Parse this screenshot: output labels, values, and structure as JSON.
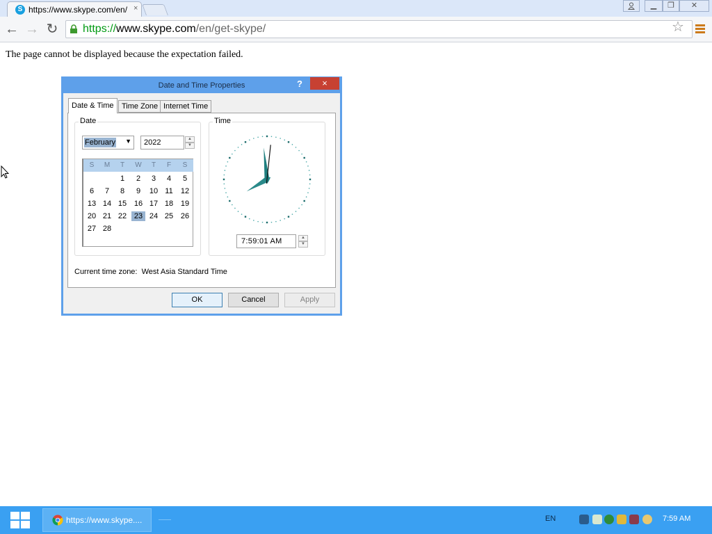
{
  "browser": {
    "tab_title": "https://www.skype.com/en/",
    "tab_close": "×",
    "url_scheme": "https://",
    "url_host": "www.skype.com",
    "url_path": "/en/get-skype/",
    "nav_back": "←",
    "nav_forward": "→",
    "nav_reload": "↻",
    "star": "☆",
    "window_controls": {
      "minimize": "▁",
      "restore": "❐",
      "close": "✕"
    },
    "accent_color": "#009a12"
  },
  "page": {
    "error_message": "The page cannot be displayed because the expectation failed."
  },
  "dialog": {
    "title": "Date and Time Properties",
    "help": "?",
    "close": "×",
    "tabs": [
      {
        "label": "Date & Time",
        "active": true
      },
      {
        "label": "Time Zone",
        "active": false
      },
      {
        "label": "Internet Time",
        "active": false
      }
    ],
    "date_group_label": "Date",
    "time_group_label": "Time",
    "month": "February",
    "year": "2022",
    "weekdays": [
      "S",
      "M",
      "T",
      "W",
      "T",
      "F",
      "S"
    ],
    "days": [
      "1",
      "2",
      "3",
      "4",
      "5",
      "6",
      "7",
      "8",
      "9",
      "10",
      "11",
      "12",
      "13",
      "14",
      "15",
      "16",
      "17",
      "18",
      "19",
      "20",
      "21",
      "22",
      "23",
      "24",
      "25",
      "26",
      "27",
      "28"
    ],
    "first_weekday_index": 2,
    "selected_day": "23",
    "time": "7:59:01 AM",
    "timezone_label": "Current time zone:",
    "timezone_value": "West Asia Standard Time",
    "buttons": {
      "ok": "OK",
      "cancel": "Cancel",
      "apply": "Apply"
    },
    "clock": {
      "hour": 7,
      "minute": 59,
      "second": 1
    }
  },
  "taskbar": {
    "task_label": "https://www.skype....",
    "language": "EN",
    "clock": "7:59 AM",
    "tray_icons": [
      "network-icon",
      "notes-icon",
      "globe-icon",
      "shield-icon",
      "people-icon",
      "sync-icon"
    ]
  }
}
